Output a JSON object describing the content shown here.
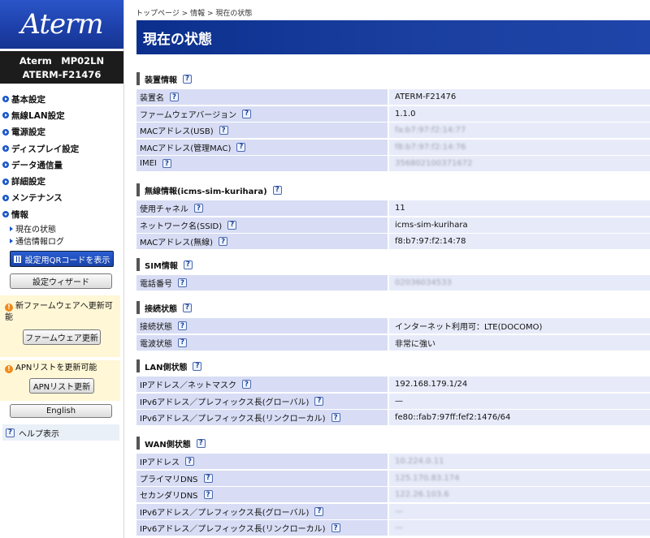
{
  "logo": "Aterm",
  "model": {
    "line1": "Aterm　MP02LN",
    "line2": "ATERM-F21476"
  },
  "nav": [
    {
      "label": "基本設定",
      "open": false
    },
    {
      "label": "無線LAN設定",
      "open": false
    },
    {
      "label": "電源設定",
      "open": false
    },
    {
      "label": "ディスプレイ設定",
      "open": false
    },
    {
      "label": "データ通信量",
      "open": false
    },
    {
      "label": "詳細設定",
      "open": false
    },
    {
      "label": "メンテナンス",
      "open": false
    },
    {
      "label": "情報",
      "open": true
    }
  ],
  "nav_sub": [
    "現在の状態",
    "通信情報ログ"
  ],
  "sidebar": {
    "qr_button": "設定用QRコードを表示",
    "wizard_button": "設定ウィザード",
    "fw_notice": "新ファームウェアへ更新可能",
    "fw_button": "ファームウェア更新",
    "apn_notice": "APNリストを更新可能",
    "apn_button": "APNリスト更新",
    "english_button": "English",
    "help_label": "ヘルプ表示",
    "help_icon": "?",
    "warn_icon": "!"
  },
  "breadcrumb": "トップページ > 情報 > 現在の状態",
  "page_title": "現在の状態",
  "help_mark": "?",
  "sections": [
    {
      "title": "装置情報",
      "rows": [
        {
          "label": "装置名",
          "value": "ATERM-F21476",
          "blurred": false
        },
        {
          "label": "ファームウェアバージョン",
          "value": "1.1.0",
          "blurred": false
        },
        {
          "label": "MACアドレス(USB)",
          "value": "fa:b7:97:f2:14:77",
          "blurred": true
        },
        {
          "label": "MACアドレス(管理MAC)",
          "value": "f8:b7:97:f2:14:76",
          "blurred": true
        },
        {
          "label": "IMEI",
          "value": "356802100371672",
          "blurred": true
        }
      ]
    },
    {
      "title": "無線情報(icms-sim-kurihara)",
      "rows": [
        {
          "label": "使用チャネル",
          "value": "11",
          "blurred": false
        },
        {
          "label": "ネットワーク名(SSID)",
          "value": "icms-sim-kurihara",
          "blurred": false
        },
        {
          "label": "MACアドレス(無線)",
          "value": "f8:b7:97:f2:14:78",
          "blurred": false
        }
      ]
    },
    {
      "title": "SIM情報",
      "rows": [
        {
          "label": "電話番号",
          "value": "02036034533",
          "blurred": true
        }
      ]
    },
    {
      "title": "接続状態",
      "rows": [
        {
          "label": "接続状態",
          "value": "インターネット利用可：LTE(DOCOMO)",
          "blurred": false
        },
        {
          "label": "電波状態",
          "value": "非常に強い",
          "blurred": false
        }
      ]
    },
    {
      "title": "LAN側状態",
      "rows": [
        {
          "label": "IPアドレス／ネットマスク",
          "value": "192.168.179.1/24",
          "blurred": false
        },
        {
          "label": "IPv6アドレス／プレフィックス長(グローバル)",
          "value": "—",
          "blurred": false
        },
        {
          "label": "IPv6アドレス／プレフィックス長(リンクローカル)",
          "value": "fe80::fab7:97ff:fef2:1476/64",
          "blurred": false
        }
      ]
    },
    {
      "title": "WAN側状態",
      "rows": [
        {
          "label": "IPアドレス",
          "value": "10.224.0.11",
          "blurred": true
        },
        {
          "label": "プライマリDNS",
          "value": "125.170.83.174",
          "blurred": true
        },
        {
          "label": "セカンダリDNS",
          "value": "122.26.103.6",
          "blurred": true
        },
        {
          "label": "IPv6アドレス／プレフィックス長(グローバル)",
          "value": "—",
          "blurred": true
        },
        {
          "label": "IPv6アドレス／プレフィックス長(リンクローカル)",
          "value": "—",
          "blurred": true
        }
      ]
    }
  ]
}
